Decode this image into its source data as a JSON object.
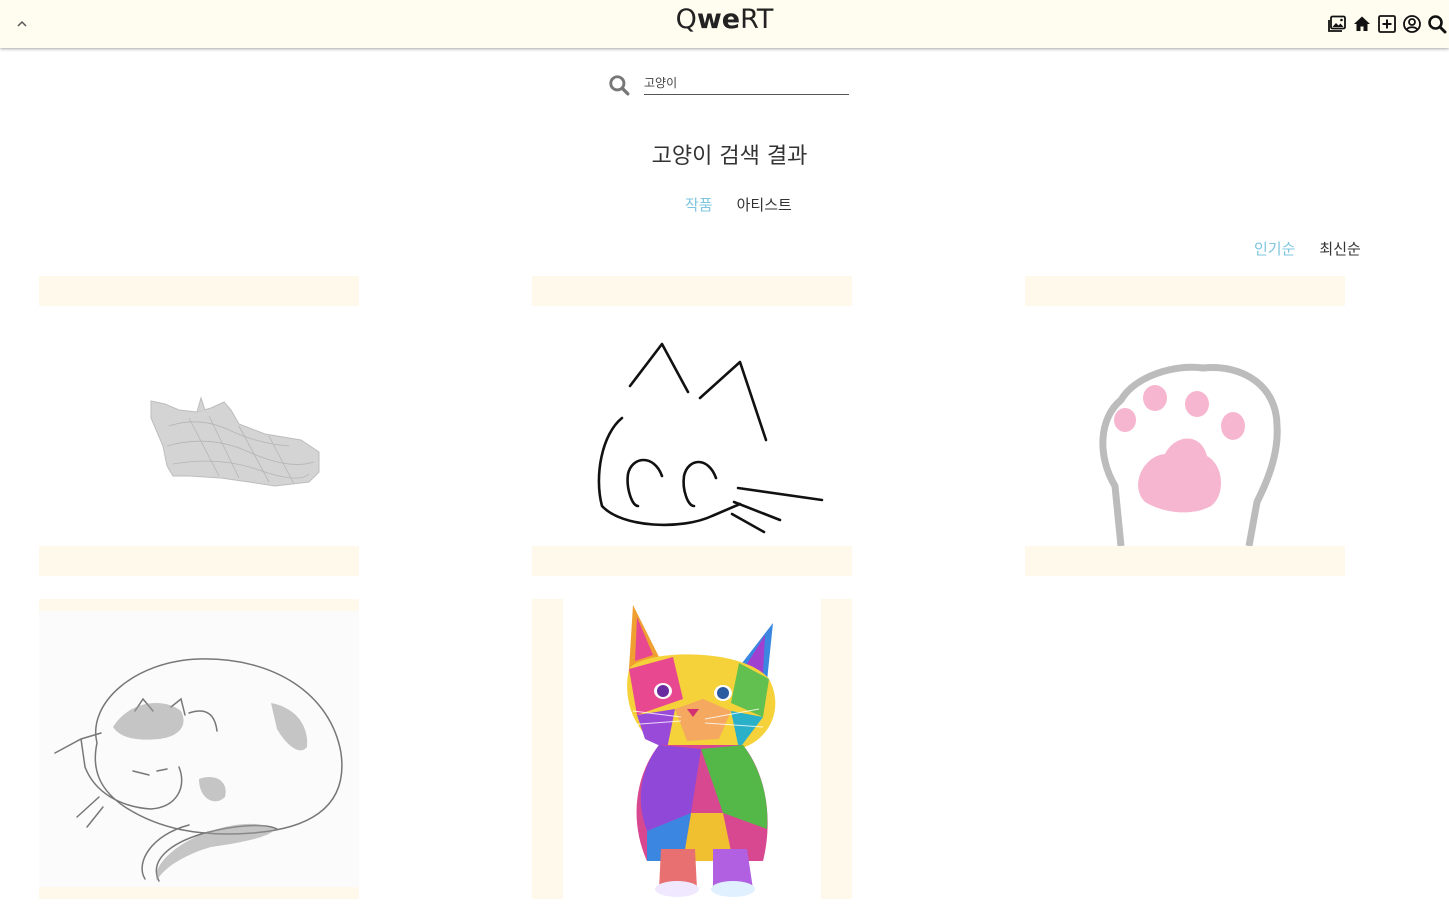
{
  "header": {
    "logo": {
      "part1": "Q",
      "part2": "we",
      "part3": "RT"
    },
    "icons": [
      "gallery-icon",
      "home-icon",
      "add-icon",
      "user-icon",
      "search-icon"
    ]
  },
  "search": {
    "value": "고양이"
  },
  "results": {
    "title": "고양이 검색 결과",
    "tabs": [
      {
        "label": "작품",
        "active": true
      },
      {
        "label": "아티스트",
        "active": false
      }
    ],
    "sort": [
      {
        "label": "인기순",
        "active": true
      },
      {
        "label": "최신순",
        "active": false
      }
    ]
  },
  "colors": {
    "accent": "#7ec6e0",
    "header_bg": "#fffdf0",
    "card_band": "#fff9ec"
  },
  "artworks": [
    {
      "subject": "grey-pencil-lying-cat"
    },
    {
      "subject": "black-line-cat-face"
    },
    {
      "subject": "cat-paw-pink-pads"
    },
    {
      "subject": "sleeping-cat-pencil-sketch"
    },
    {
      "subject": "colorful-pop-art-kitten"
    }
  ]
}
